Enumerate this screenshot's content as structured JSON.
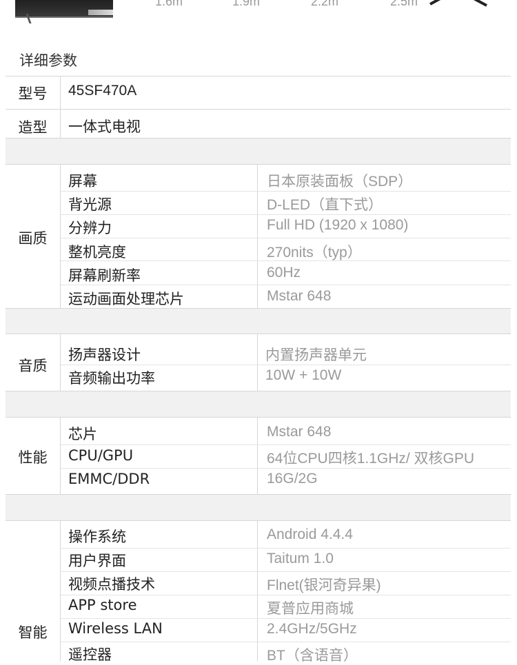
{
  "header": {
    "distances": [
      "1.6m",
      "1.9m",
      "2.2m",
      "2.5m"
    ],
    "section_title": "详细参数"
  },
  "basic": [
    {
      "label": "型号",
      "value": "45SF470A"
    },
    {
      "label": "造型",
      "value": "一体式电视"
    }
  ],
  "groups": [
    {
      "category": "画质",
      "rows": [
        {
          "label": "屏幕",
          "value": "日本原装面板（SDP）"
        },
        {
          "label": "背光源",
          "value": "D-LED（直下式）"
        },
        {
          "label": "分辨力",
          "value": "Full HD (1920 x 1080)"
        },
        {
          "label": "整机亮度",
          "value": "270nits（typ）"
        },
        {
          "label": "屏幕刷新率",
          "value": "60Hz"
        },
        {
          "label": "运动画面处理芯片",
          "value": "Mstar 648"
        }
      ]
    },
    {
      "category": "音质",
      "rows": [
        {
          "label": "扬声器设计",
          "value": "内置扬声器单元"
        },
        {
          "label": "音频输出功率",
          "value": "10W + 10W"
        }
      ]
    },
    {
      "category": "性能",
      "rows": [
        {
          "label": "芯片",
          "value": "Mstar 648"
        },
        {
          "label": "CPU/GPU",
          "value": "64位CPU四核1.1GHz/ 双核GPU"
        },
        {
          "label": "EMMC/DDR",
          "value": "16G/2G"
        }
      ]
    },
    {
      "category": "智能",
      "rows": [
        {
          "label": "操作系统",
          "value": "Android 4.4.4"
        },
        {
          "label": "用户界面",
          "value": "Taitum 1.0"
        },
        {
          "label": "视频点播技术",
          "value": "Flnet(银河奇异果)"
        },
        {
          "label": "APP store",
          "value": "夏普应用商城"
        },
        {
          "label": "Wireless LAN",
          "value": "2.4GHz/5GHz"
        },
        {
          "label": "遥控器",
          "value": "BT（含语音）"
        }
      ]
    }
  ]
}
